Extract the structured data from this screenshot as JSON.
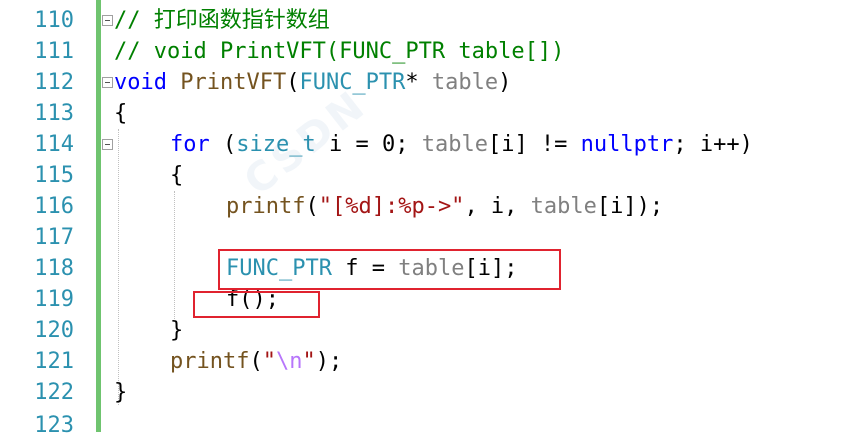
{
  "editor": {
    "lines": [
      {
        "num": "110"
      },
      {
        "num": "111"
      },
      {
        "num": "112"
      },
      {
        "num": "113"
      },
      {
        "num": "114"
      },
      {
        "num": "115"
      },
      {
        "num": "116"
      },
      {
        "num": "117"
      },
      {
        "num": "118"
      },
      {
        "num": "119"
      },
      {
        "num": "120"
      },
      {
        "num": "121"
      },
      {
        "num": "122"
      },
      {
        "num": "123"
      }
    ],
    "tokens": {
      "l110_comment": "// 打印函数指针数组",
      "l111_comment": "// void PrintVFT(FUNC_PTR table[])",
      "l112_void": "void",
      "l112_fn": "PrintVFT",
      "l112_open": "(",
      "l112_type": "FUNC_PTR",
      "l112_star": "*",
      "l112_param": "table",
      "l112_close": ")",
      "l113_brace": "{",
      "l114_for": "for",
      "l114_open": "(",
      "l114_sizet": "size_t",
      "l114_i": "i = 0;",
      "l114_table": "table",
      "l114_idx": "[i] != ",
      "l114_nullptr": "nullptr",
      "l114_rest": "; i++)",
      "l115_brace": "{",
      "l116_printf": "printf",
      "l116_open": "(",
      "l116_str": "\"[%d]:%p->\"",
      "l116_mid": ", i, ",
      "l116_table": "table",
      "l116_end": "[i]);",
      "l118_type": "FUNC_PTR",
      "l118_var": "f",
      "l118_eq": " = ",
      "l118_table": "table",
      "l118_end": "[i];",
      "l119_call": "f",
      "l119_end": "();",
      "l120_brace": "}",
      "l121_printf": "printf",
      "l121_open": "(",
      "l121_q1": "\"",
      "l121_esc": "\\n",
      "l121_q2": "\"",
      "l121_end": ");",
      "l122_brace": "}"
    },
    "colors": {
      "keyword": "#0000ff",
      "type": "#2b91af",
      "comment": "#008000",
      "string": "#a31515",
      "line_number": "#2b91af",
      "change_bar": "#6fc46f",
      "highlight_box": "#e0232f"
    }
  }
}
